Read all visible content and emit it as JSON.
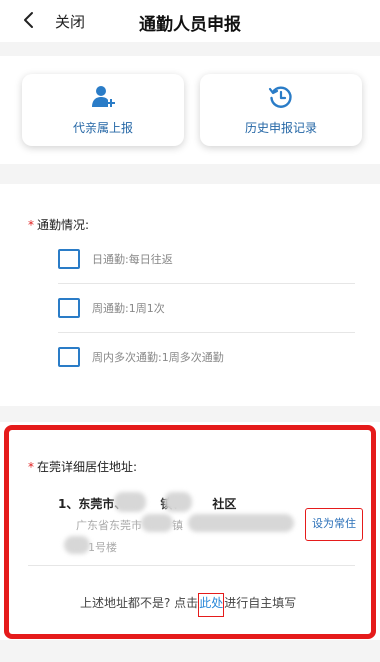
{
  "nav": {
    "back_icon": "chevron-left-icon",
    "close_label": "关闭",
    "title": "通勤人员申报"
  },
  "cards": [
    {
      "label": "代亲属上报",
      "icon": "add-user-icon"
    },
    {
      "label": "历史申报记录",
      "icon": "history-icon"
    }
  ],
  "commute": {
    "required_mark": "*",
    "title": "通勤情况:",
    "options": [
      {
        "label": "日通勤:每日往返",
        "checked": false
      },
      {
        "label": "周通勤:1周1次",
        "checked": false
      },
      {
        "label": "周内多次通勤:1周多次通勤",
        "checked": false
      }
    ]
  },
  "address": {
    "required_mark": "*",
    "title": "在莞详细居住地址:",
    "item_name_a": "1、东莞市、",
    "item_name_b": "镇、",
    "item_name_c": "社区",
    "detail_a": "广东省东莞市",
    "detail_b": "镇",
    "detail_line2": "1号楼",
    "set_default_label": "设为常住",
    "footer_prefix": "上述地址都不是? 点击",
    "footer_link": "此处",
    "footer_suffix": "进行自主填写"
  },
  "colors": {
    "accent": "#2a7cc7",
    "highlight_frame": "#e51b1b",
    "link": "#2a88d8"
  }
}
